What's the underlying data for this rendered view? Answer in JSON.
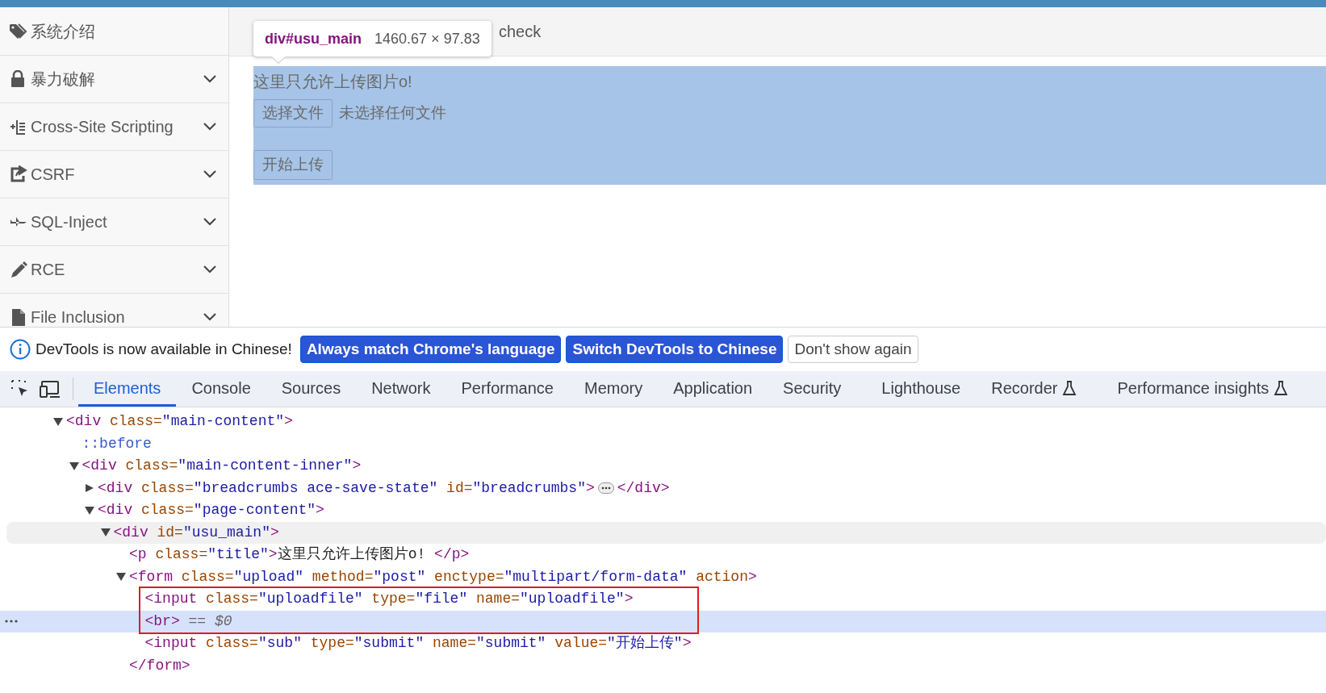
{
  "sidebar": {
    "items": [
      {
        "label": "系统介绍",
        "expandable": false
      },
      {
        "label": "暴力破解",
        "expandable": true
      },
      {
        "label": "Cross-Site Scripting",
        "expandable": true
      },
      {
        "label": "CSRF",
        "expandable": true
      },
      {
        "label": "SQL-Inject",
        "expandable": true
      },
      {
        "label": "RCE",
        "expandable": true
      },
      {
        "label": "File Inclusion",
        "expandable": true
      }
    ]
  },
  "breadcrumb": {
    "text": "check"
  },
  "content": {
    "title": "这里只允许上传图片o!",
    "file_button": "选择文件",
    "file_status": "未选择任何文件",
    "submit_button": "开始上传",
    "highlighted": true
  },
  "inspect_tooltip": {
    "selector": "div#usu_main",
    "size": "1460.67 × 97.83"
  },
  "devtools": {
    "banner": {
      "text": "DevTools is now available in Chinese!",
      "buttons": [
        {
          "label": "Always match Chrome's language",
          "kind": "primary"
        },
        {
          "label": "Switch DevTools to Chinese",
          "kind": "primary"
        },
        {
          "label": "Don't show again",
          "kind": "secondary"
        }
      ]
    },
    "tabs": [
      {
        "label": "Elements",
        "selected": true,
        "experimental": false
      },
      {
        "label": "Console",
        "selected": false,
        "experimental": false
      },
      {
        "label": "Sources",
        "selected": false,
        "experimental": false
      },
      {
        "label": "Network",
        "selected": false,
        "experimental": false
      },
      {
        "label": "Performance",
        "selected": false,
        "experimental": false
      },
      {
        "label": "Memory",
        "selected": false,
        "experimental": false
      },
      {
        "label": "Application",
        "selected": false,
        "experimental": false
      },
      {
        "label": "Security",
        "selected": false,
        "experimental": false
      },
      {
        "label": "Lighthouse",
        "selected": false,
        "experimental": false
      },
      {
        "label": "Recorder",
        "selected": false,
        "experimental": true
      },
      {
        "label": "Performance insights",
        "selected": false,
        "experimental": true
      }
    ],
    "tree": [
      {
        "expanded": true,
        "selected": false,
        "hovered": false,
        "annotated": false,
        "tokens": [
          {
            "kind": "tag",
            "text": "<div"
          },
          {
            "kind": "attr",
            "text": " class="
          },
          {
            "kind": "value",
            "text": "\"main-content\""
          },
          {
            "kind": "tag",
            "text": ">"
          }
        ],
        "children": [
          {
            "selected": false,
            "hovered": false,
            "annotated": false,
            "tokens": [
              {
                "kind": "pseudo",
                "text": "::before"
              }
            ]
          },
          {
            "expanded": true,
            "selected": false,
            "hovered": false,
            "annotated": false,
            "tokens": [
              {
                "kind": "tag",
                "text": "<div"
              },
              {
                "kind": "attr",
                "text": " class="
              },
              {
                "kind": "value",
                "text": "\"main-content-inner\""
              },
              {
                "kind": "tag",
                "text": ">"
              }
            ],
            "children": [
              {
                "expanded": false,
                "selected": false,
                "hovered": false,
                "annotated": false,
                "tokens": [
                  {
                    "kind": "tag",
                    "text": "<div"
                  },
                  {
                    "kind": "attr",
                    "text": " class="
                  },
                  {
                    "kind": "value",
                    "text": "\"breadcrumbs ace-save-state\""
                  },
                  {
                    "kind": "attr",
                    "text": " id="
                  },
                  {
                    "kind": "value",
                    "text": "\"breadcrumbs\""
                  },
                  {
                    "kind": "tag",
                    "text": ">"
                  }
                ],
                "closing_tokens": [
                  {
                    "kind": "tag",
                    "text": "</div>"
                  }
                ]
              },
              {
                "expanded": true,
                "selected": false,
                "hovered": false,
                "annotated": false,
                "tokens": [
                  {
                    "kind": "tag",
                    "text": "<div"
                  },
                  {
                    "kind": "attr",
                    "text": " class="
                  },
                  {
                    "kind": "value",
                    "text": "\"page-content\""
                  },
                  {
                    "kind": "tag",
                    "text": ">"
                  }
                ],
                "children": [
                  {
                    "expanded": true,
                    "selected": false,
                    "hovered": true,
                    "annotated": false,
                    "tokens": [
                      {
                        "kind": "tag",
                        "text": "<div"
                      },
                      {
                        "kind": "attr",
                        "text": " id="
                      },
                      {
                        "kind": "value",
                        "text": "\"usu_main\""
                      },
                      {
                        "kind": "tag",
                        "text": ">"
                      }
                    ],
                    "children": [
                      {
                        "selected": false,
                        "hovered": false,
                        "annotated": false,
                        "tokens": [
                          {
                            "kind": "tag",
                            "text": "<p"
                          },
                          {
                            "kind": "attr",
                            "text": " class="
                          },
                          {
                            "kind": "value",
                            "text": "\"title\""
                          },
                          {
                            "kind": "tag",
                            "text": ">"
                          },
                          {
                            "kind": "text",
                            "text": "这里只允许上传图片o! "
                          },
                          {
                            "kind": "tag",
                            "text": "</p>"
                          }
                        ]
                      },
                      {
                        "expanded": true,
                        "selected": false,
                        "hovered": false,
                        "annotated": false,
                        "tokens": [
                          {
                            "kind": "tag",
                            "text": "<form"
                          },
                          {
                            "kind": "attr",
                            "text": " class="
                          },
                          {
                            "kind": "value",
                            "text": "\"upload\""
                          },
                          {
                            "kind": "attr",
                            "text": " method="
                          },
                          {
                            "kind": "value",
                            "text": "\"post\""
                          },
                          {
                            "kind": "attr",
                            "text": " enctype="
                          },
                          {
                            "kind": "value",
                            "text": "\"multipart/form-data\""
                          },
                          {
                            "kind": "attr",
                            "text": " action"
                          },
                          {
                            "kind": "tag",
                            "text": ">"
                          }
                        ],
                        "closing": [
                          {
                            "kind": "tag",
                            "text": "</form>"
                          }
                        ],
                        "children": [
                          {
                            "selected": false,
                            "hovered": false,
                            "annotated": true,
                            "tokens": [
                              {
                                "kind": "tag",
                                "text": "<input"
                              },
                              {
                                "kind": "attr",
                                "text": " class="
                              },
                              {
                                "kind": "value",
                                "text": "\"uploadfile\""
                              },
                              {
                                "kind": "attr",
                                "text": " type="
                              },
                              {
                                "kind": "value",
                                "text": "\"file\""
                              },
                              {
                                "kind": "attr",
                                "text": " name="
                              },
                              {
                                "kind": "value",
                                "text": "\"uploadfile\""
                              },
                              {
                                "kind": "tag",
                                "text": ">"
                              }
                            ]
                          },
                          {
                            "selected": true,
                            "hovered": false,
                            "annotated": true,
                            "tokens": [
                              {
                                "kind": "tag",
                                "text": "<br>"
                              },
                              {
                                "kind": "comment",
                                "text": " == $0"
                              }
                            ]
                          },
                          {
                            "selected": false,
                            "hovered": false,
                            "annotated": false,
                            "tokens": [
                              {
                                "kind": "tag",
                                "text": "<input"
                              },
                              {
                                "kind": "attr",
                                "text": " class="
                              },
                              {
                                "kind": "value",
                                "text": "\"sub\""
                              },
                              {
                                "kind": "attr",
                                "text": " type="
                              },
                              {
                                "kind": "value",
                                "text": "\"submit\""
                              },
                              {
                                "kind": "attr",
                                "text": " name="
                              },
                              {
                                "kind": "value",
                                "text": "\"submit\""
                              },
                              {
                                "kind": "attr",
                                "text": " value="
                              },
                              {
                                "kind": "value",
                                "text": "\"开始上传\""
                              },
                              {
                                "kind": "tag",
                                "text": ">"
                              }
                            ]
                          }
                        ]
                      }
                    ]
                  }
                ]
              }
            ]
          }
        ]
      }
    ]
  }
}
